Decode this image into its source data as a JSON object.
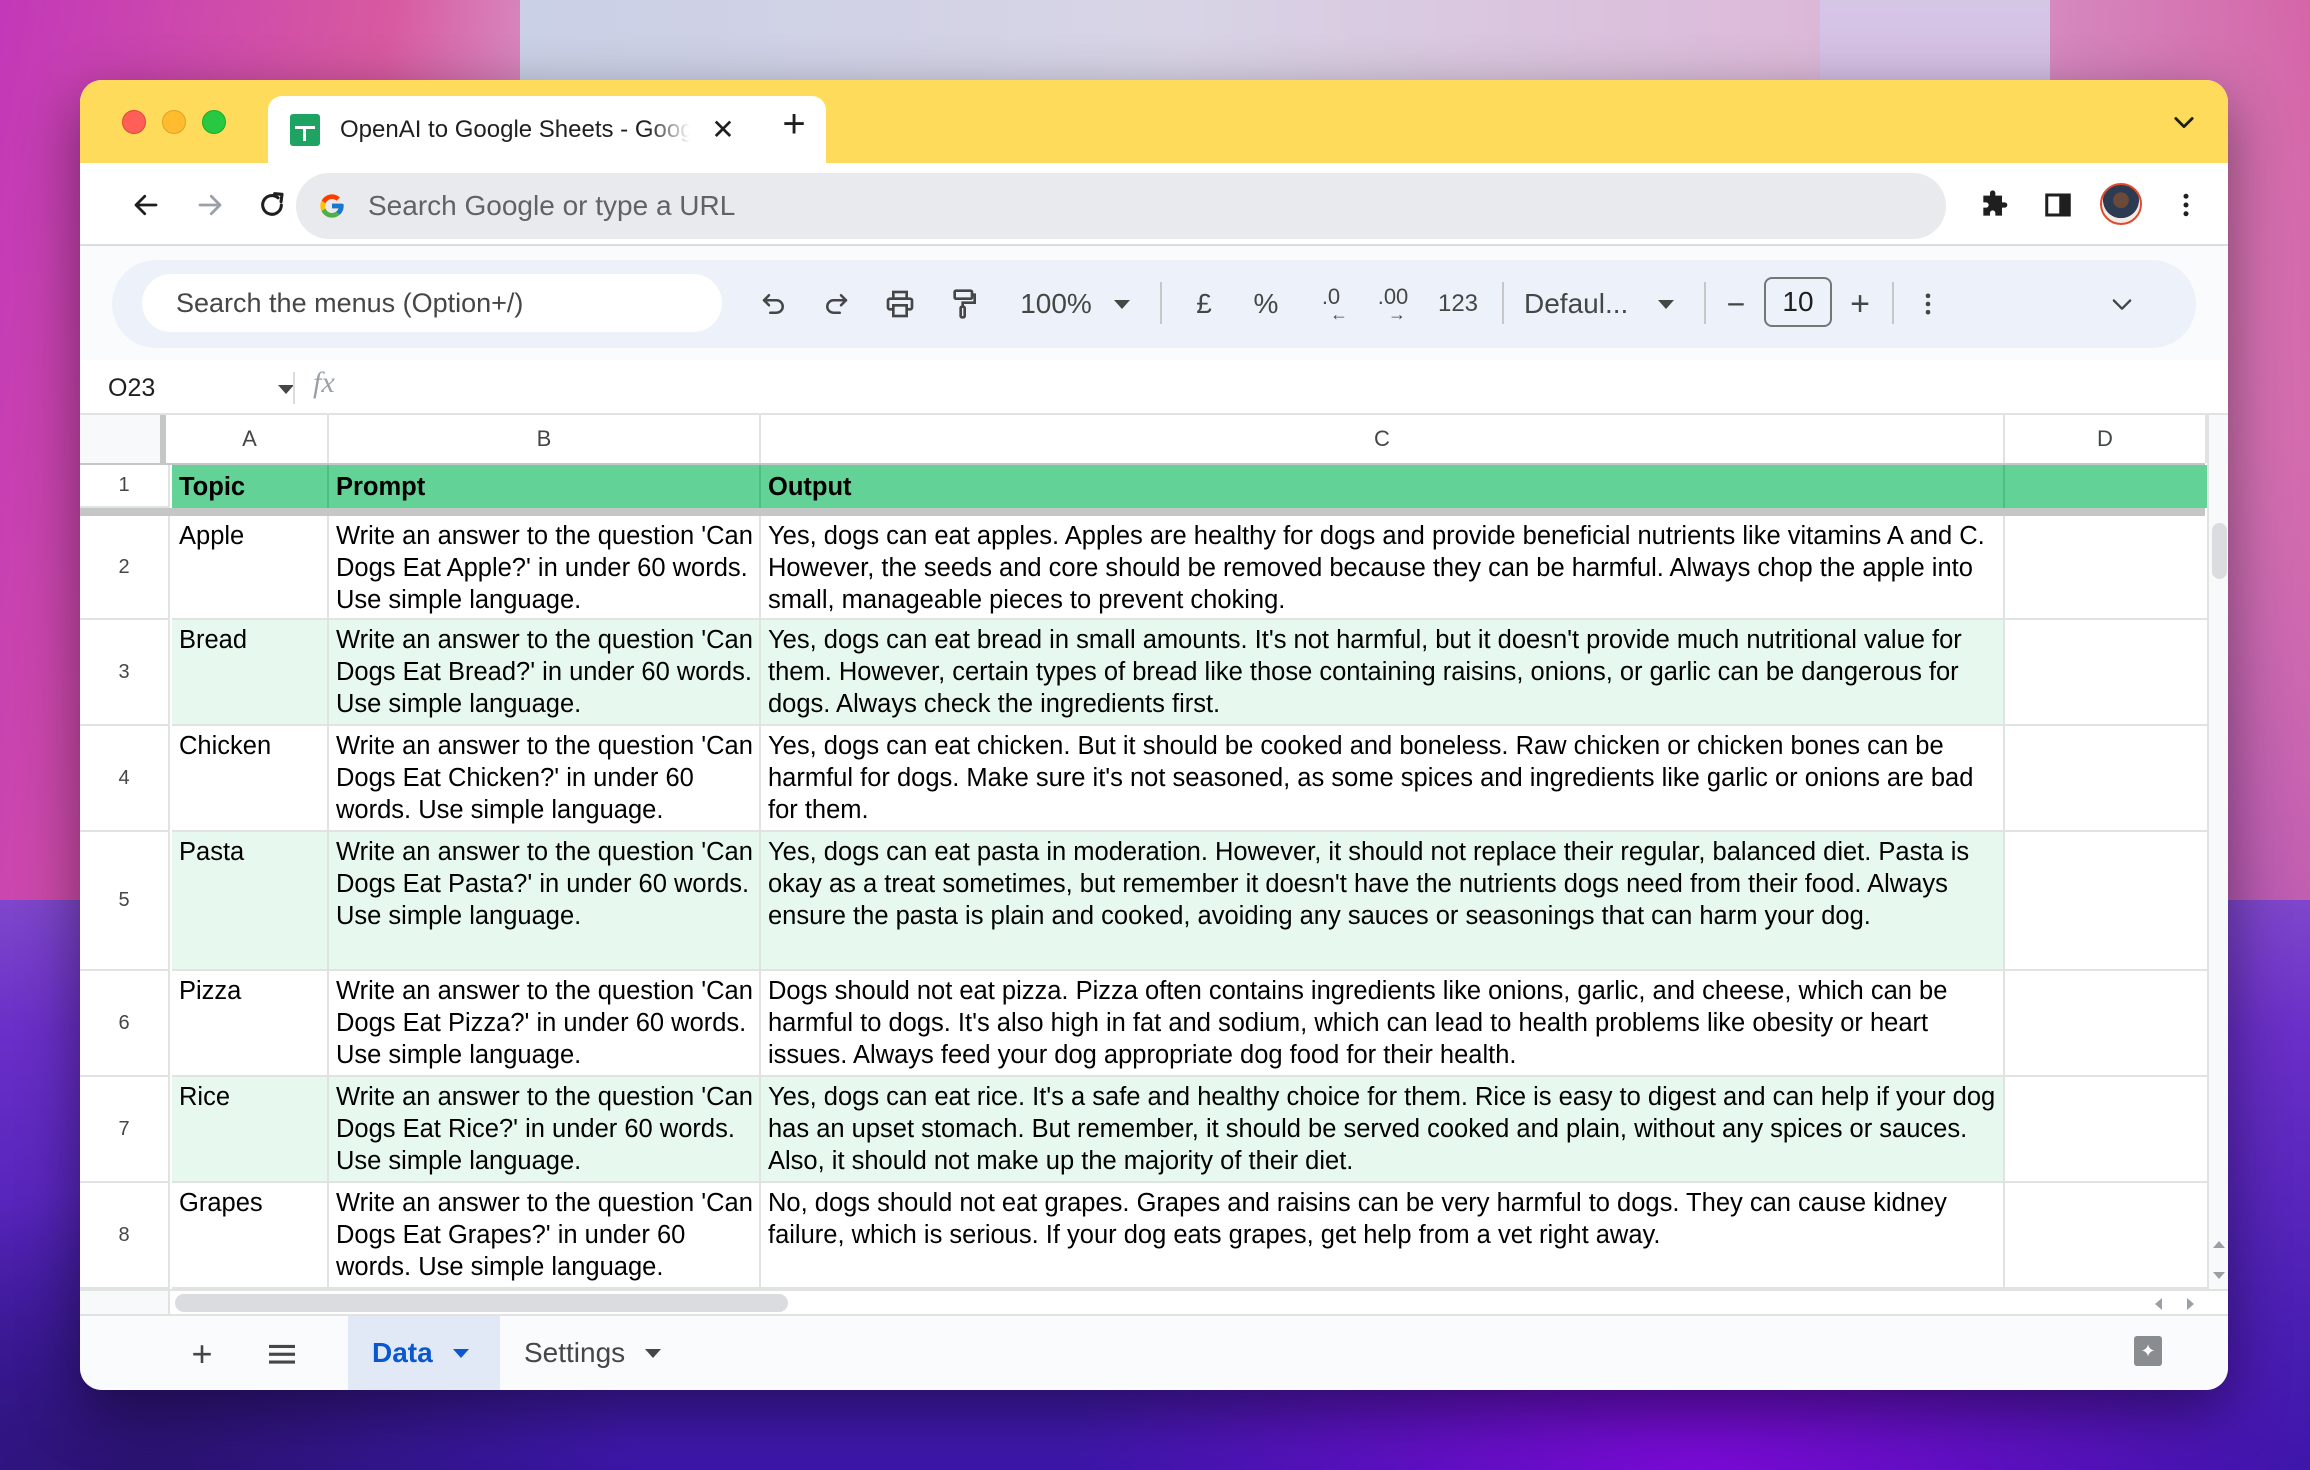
{
  "browser": {
    "tab_title": "OpenAI to Google Sheets - Google Sheets",
    "tab_close_icon": "close-icon",
    "new_tab_label": "+",
    "omnibox_placeholder": "Search Google or type a URL",
    "colors": {
      "tabstrip": "#FFDB5C",
      "traffic_red": "#FE5F57",
      "traffic_yellow": "#FEBC2E",
      "traffic_green": "#28C840"
    }
  },
  "sheets_toolbar": {
    "menu_search_placeholder": "Search the menus (Option+/)",
    "zoom": "100%",
    "currency_symbol": "£",
    "percent_symbol": "%",
    "decrease_decimal": ".0",
    "increase_decimal": ".00",
    "number_format": "123",
    "font": "Defaul...",
    "font_size": "10",
    "minus": "−",
    "plus": "+"
  },
  "formula_bar": {
    "name_box": "O23",
    "fx_label": "fx",
    "formula": ""
  },
  "grid": {
    "columns": [
      "A",
      "B",
      "C",
      "D"
    ],
    "header_row": {
      "row_number": "1",
      "cells": [
        "Topic",
        "Prompt",
        "Output",
        ""
      ]
    },
    "header_color": "#63D297",
    "band_color": "#E7F9EF",
    "rows": [
      {
        "row_number": "2",
        "topic": "Apple",
        "prompt": "Write an answer to the question 'Can Dogs Eat Apple?' in under 60 words. Use simple language.",
        "output": "Yes, dogs can eat apples. Apples are healthy for dogs and provide beneficial nutrients like vitamins A and C. However, the seeds and core should be removed because they can be harmful. Always chop the apple into small, manageable pieces to prevent choking.",
        "d": ""
      },
      {
        "row_number": "3",
        "topic": "Bread",
        "prompt": "Write an answer to the question 'Can Dogs Eat Bread?' in under 60 words. Use simple language.",
        "output": "Yes, dogs can eat bread in small amounts. It's not harmful, but it doesn't provide much nutritional value for them. However, certain types of bread like those containing raisins, onions, or garlic can be dangerous for dogs. Always check the ingredients first.",
        "d": ""
      },
      {
        "row_number": "4",
        "topic": "Chicken",
        "prompt": "Write an answer to the question 'Can Dogs Eat Chicken?' in under 60 words. Use simple language.",
        "output": "Yes, dogs can eat chicken. But it should be cooked and boneless. Raw chicken or chicken bones can be harmful for dogs. Make sure it's not seasoned, as some spices and ingredients like garlic or onions are bad for them.",
        "d": ""
      },
      {
        "row_number": "5",
        "topic": "Pasta",
        "prompt": "Write an answer to the question 'Can Dogs Eat Pasta?' in under 60 words. Use simple language.",
        "output": "Yes, dogs can eat pasta in moderation. However, it should not replace their regular, balanced diet. Pasta is okay as a treat sometimes, but remember it doesn't have the nutrients dogs need from their food. Always ensure the pasta is plain and cooked, avoiding any sauces or seasonings that can harm your dog.",
        "d": ""
      },
      {
        "row_number": "6",
        "topic": "Pizza",
        "prompt": "Write an answer to the question 'Can Dogs Eat Pizza?' in under 60 words. Use simple language.",
        "output": "Dogs should not eat pizza. Pizza often contains ingredients like onions, garlic, and cheese, which can be harmful to dogs. It's also high in fat and sodium, which can lead to health problems like obesity or heart issues. Always feed your dog appropriate dog food for their health.",
        "d": ""
      },
      {
        "row_number": "7",
        "topic": "Rice",
        "prompt": "Write an answer to the question 'Can Dogs Eat Rice?' in under 60 words. Use simple language.",
        "output": "Yes, dogs can eat rice. It's a safe and healthy choice for them. Rice is easy to digest and can help if your dog has an upset stomach. But remember, it should be served cooked and plain, without any spices or sauces. Also, it should not make up the majority of their diet.",
        "d": ""
      },
      {
        "row_number": "8",
        "topic": "Grapes",
        "prompt": "Write an answer to the question 'Can Dogs Eat Grapes?' in under 60 words. Use simple language.",
        "output": "No, dogs should not eat grapes. Grapes and raisins can be very harmful to dogs. They can cause kidney failure, which is serious. If your dog eats grapes, get help from a vet right away.",
        "d": ""
      }
    ]
  },
  "sheet_tabs": {
    "add_label": "+",
    "tabs": [
      {
        "label": "Data",
        "active": true
      },
      {
        "label": "Settings",
        "active": false
      }
    ],
    "active_color": "#0B57D0"
  }
}
